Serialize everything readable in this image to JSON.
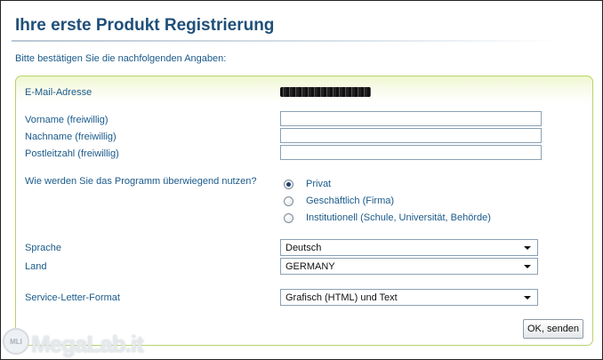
{
  "header": {
    "title": "Ihre erste Produkt Registrierung",
    "intro": "Bitte bestätigen Sie die nachfolgenden Angaben:"
  },
  "form": {
    "email_label": "E-Mail-Adresse",
    "first_name_label": "Vorname (freiwillig)",
    "first_name_value": "",
    "last_name_label": "Nachname (freiwillig)",
    "last_name_value": "",
    "zip_label": "Postleitzahl (freiwillig)",
    "zip_value": "",
    "usage_question": "Wie werden Sie das Programm überwiegend nutzen?",
    "usage_options": [
      {
        "label": "Privat",
        "checked": true
      },
      {
        "label": "Geschäftlich (Firma)",
        "checked": false
      },
      {
        "label": "Institutionell (Schule, Universität, Behörde)",
        "checked": false
      }
    ],
    "language_label": "Sprache",
    "language_value": "Deutsch",
    "country_label": "Land",
    "country_value": "GERMANY",
    "format_label": "Service-Letter-Format",
    "format_value": "Grafisch (HTML) und Text",
    "submit_label": "OK, senden"
  },
  "watermark": {
    "logo_text": "MLI",
    "text": "MegaLab.it"
  },
  "colors": {
    "title": "#1f4f7a",
    "label": "#1a5a8a",
    "panel_border": "#b7d36a"
  }
}
